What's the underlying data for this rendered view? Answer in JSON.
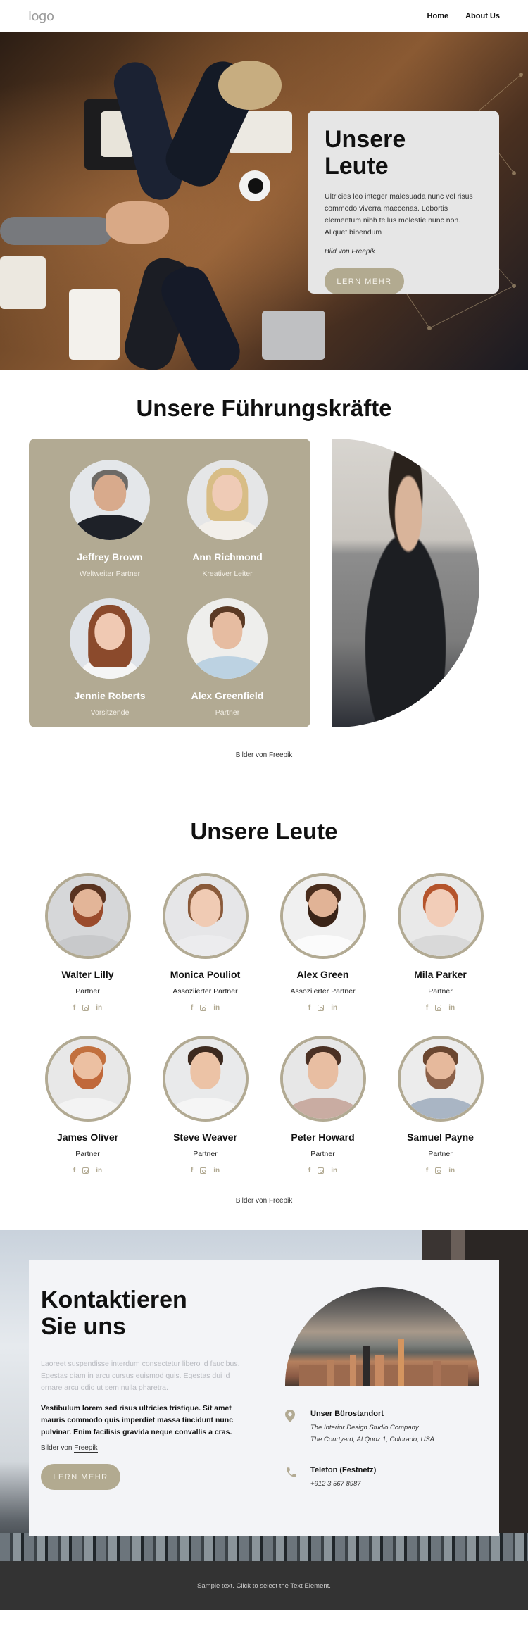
{
  "header": {
    "logo": "logo",
    "nav": [
      {
        "label": "Home"
      },
      {
        "label": "About Us"
      }
    ]
  },
  "hero": {
    "title_line1": "Unsere",
    "title_line2": "Leute",
    "text": "Ultricies leo integer malesuada nunc vel risus commodo viverra maecenas. Lobortis elementum nibh tellus molestie nunc non. Aliquet bibendum",
    "credit_prefix": "Bild von ",
    "credit_link": "Freepik",
    "button": "LERN MEHR"
  },
  "leaders": {
    "title": "Unsere Führungskräfte",
    "items": [
      {
        "name": "Jeffrey Brown",
        "role": "Weltweiter Partner"
      },
      {
        "name": "Ann Richmond",
        "role": "Kreativer Leiter"
      },
      {
        "name": "Jennie Roberts",
        "role": "Vorsitzende"
      },
      {
        "name": "Alex Greenfield",
        "role": "Partner"
      }
    ],
    "credit": "Bilder von Freepik"
  },
  "people": {
    "title": "Unsere Leute",
    "items": [
      {
        "name": "Walter Lilly",
        "role": "Partner"
      },
      {
        "name": "Monica Pouliot",
        "role": "Assoziierter Partner"
      },
      {
        "name": "Alex Green",
        "role": "Assoziierter Partner"
      },
      {
        "name": "Mila Parker",
        "role": "Partner"
      },
      {
        "name": "James Oliver",
        "role": "Partner"
      },
      {
        "name": "Steve Weaver",
        "role": "Partner"
      },
      {
        "name": "Peter Howard",
        "role": "Partner"
      },
      {
        "name": "Samuel Payne",
        "role": "Partner"
      }
    ],
    "social": {
      "facebook": "f",
      "instagram": "instagram",
      "linkedin": "in"
    },
    "credit": "Bilder von Freepik"
  },
  "contact": {
    "title_line1": "Kontaktieren",
    "title_line2": "Sie uns",
    "muted_text": "Laoreet suspendisse interdum consectetur libero id faucibus. Egestas diam in arcu cursus euismod quis. Egestas dui id ornare arcu odio ut sem nulla pharetra.",
    "bold_text": "Vestibulum lorem sed risus ultricies tristique. Sit amet mauris commodo quis imperdiet massa tincidunt nunc pulvinar. Enim facilisis gravida neque convallis a cras.",
    "credit_prefix": "Bilder von ",
    "credit_link": "Freepik",
    "button": "LERN MEHR",
    "office": {
      "title": "Unser Bürostandort",
      "line1": "The Interior Design Studio Company",
      "line2": "The Courtyard, Al Quoz 1, Colorado, USA"
    },
    "phone": {
      "title": "Telefon (Festnetz)",
      "number": "+912 3 567 8987"
    }
  },
  "footer": {
    "text": "Sample text. Click to select the Text Element."
  },
  "colors": {
    "accent": "#b2aa93",
    "footer_bg": "#333333",
    "card_bg": "#e6e6e6"
  }
}
